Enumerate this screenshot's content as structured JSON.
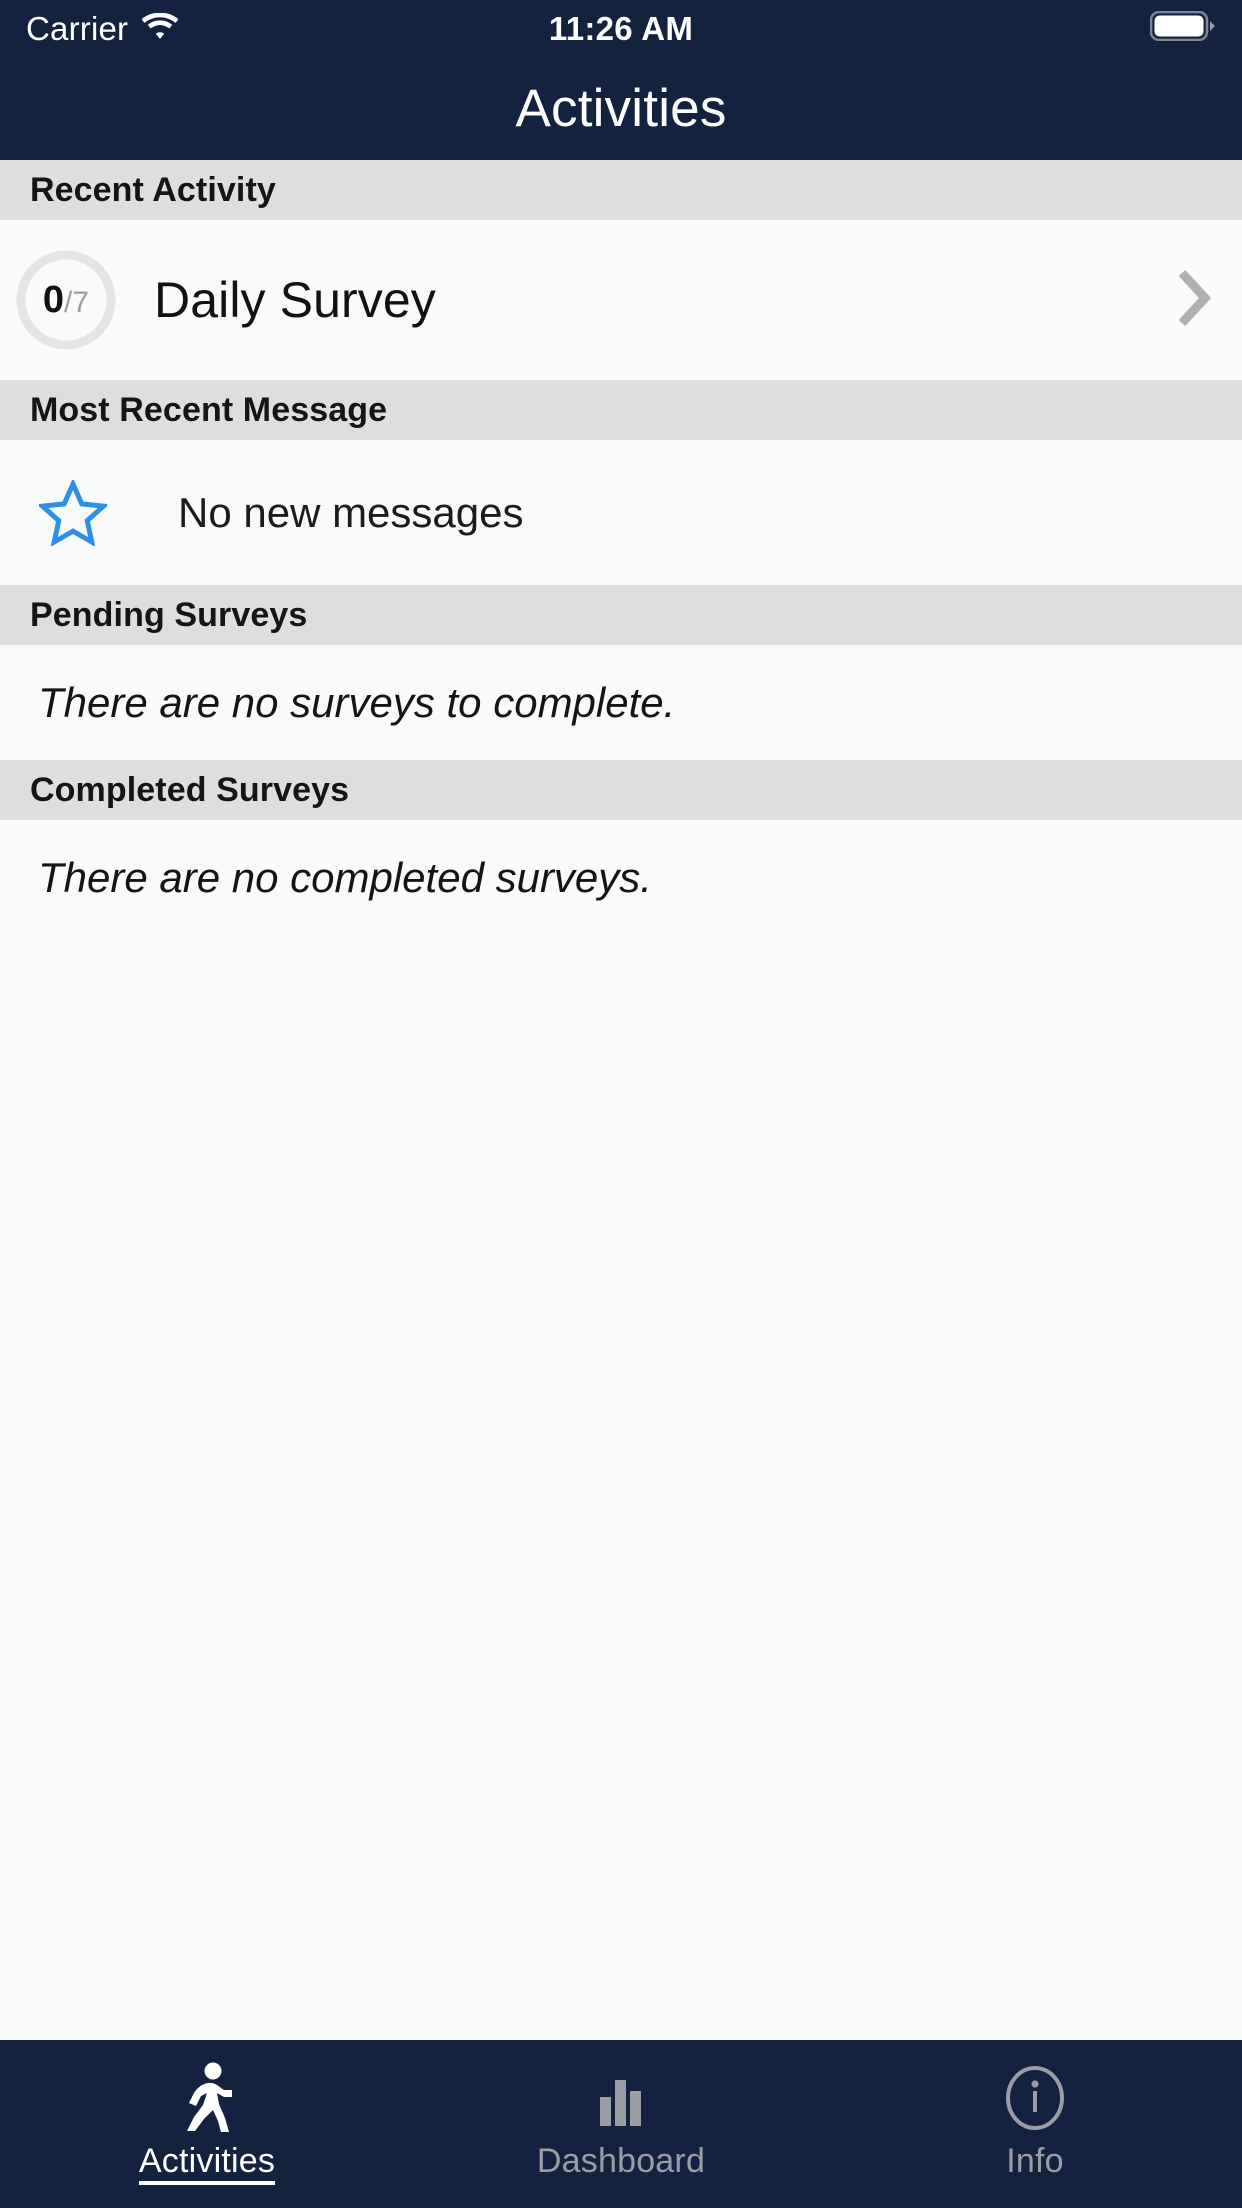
{
  "status_bar": {
    "carrier": "Carrier",
    "time": "11:26 AM",
    "wifi_icon": "wifi-icon",
    "battery_icon": "battery-full-icon"
  },
  "nav": {
    "title": "Activities"
  },
  "sections": {
    "recent_activity": {
      "header": "Recent Activity",
      "item": {
        "title": "Daily Survey",
        "progress_count": "0",
        "progress_total": "/7",
        "disclosure_icon": "chevron-right-icon"
      }
    },
    "most_recent_message": {
      "header": "Most Recent Message",
      "icon": "star-outline-icon",
      "text": "No new messages"
    },
    "pending_surveys": {
      "header": "Pending Surveys",
      "empty_text": "There are no surveys to complete."
    },
    "completed_surveys": {
      "header": "Completed Surveys",
      "empty_text": "There are no completed surveys."
    }
  },
  "tab_bar": {
    "tabs": [
      {
        "label": "Activities",
        "icon": "running-person-icon",
        "active": true
      },
      {
        "label": "Dashboard",
        "icon": "bar-chart-icon",
        "active": false
      },
      {
        "label": "Info",
        "icon": "info-circle-icon",
        "active": false
      }
    ]
  },
  "colors": {
    "navy": "#13233f",
    "section_header_bg": "#dededf",
    "page_bg": "#f7f8f8",
    "row_bg": "#f9fafa",
    "star_blue": "#2d8fe6",
    "ring_gray": "#e3e3e3",
    "inactive_tab": "#9a9da4"
  }
}
